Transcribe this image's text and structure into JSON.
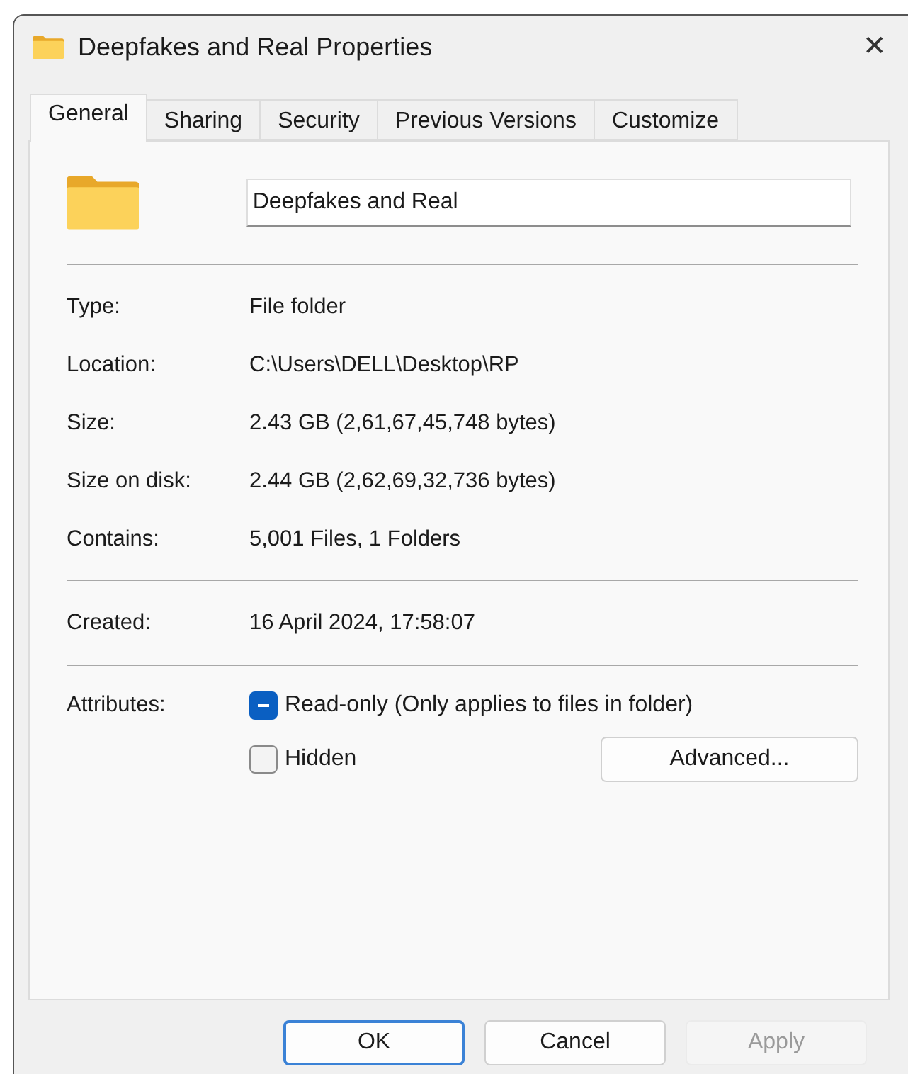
{
  "window": {
    "title": "Deepfakes and Real Properties",
    "close": "✕"
  },
  "tabs": [
    {
      "label": "General",
      "selected": true
    },
    {
      "label": "Sharing",
      "selected": false
    },
    {
      "label": "Security",
      "selected": false
    },
    {
      "label": "Previous Versions",
      "selected": false
    },
    {
      "label": "Customize",
      "selected": false
    }
  ],
  "name_field": {
    "value": "Deepfakes and Real"
  },
  "details": [
    {
      "label": "Type:",
      "value": "File folder"
    },
    {
      "label": "Location:",
      "value": "C:\\Users\\DELL\\Desktop\\RP"
    },
    {
      "label": "Size:",
      "value": "2.43 GB (2,61,67,45,748 bytes)"
    },
    {
      "label": "Size on disk:",
      "value": "2.44 GB (2,62,69,32,736 bytes)"
    },
    {
      "label": "Contains:",
      "value": "5,001 Files, 1 Folders"
    }
  ],
  "created": {
    "label": "Created:",
    "value": "16 April 2024, 17:58:07"
  },
  "attributes": {
    "label": "Attributes:",
    "options": [
      {
        "label": "Read-only (Only applies to files in folder)",
        "indeterminate": true
      },
      {
        "label": "Hidden",
        "checked": false
      }
    ],
    "advanced_button": "Advanced..."
  },
  "buttons": [
    {
      "label": "OK",
      "default": true,
      "disabled": false
    },
    {
      "label": "Cancel",
      "default": false,
      "disabled": false
    },
    {
      "label": "Apply",
      "default": false,
      "disabled": true
    }
  ]
}
